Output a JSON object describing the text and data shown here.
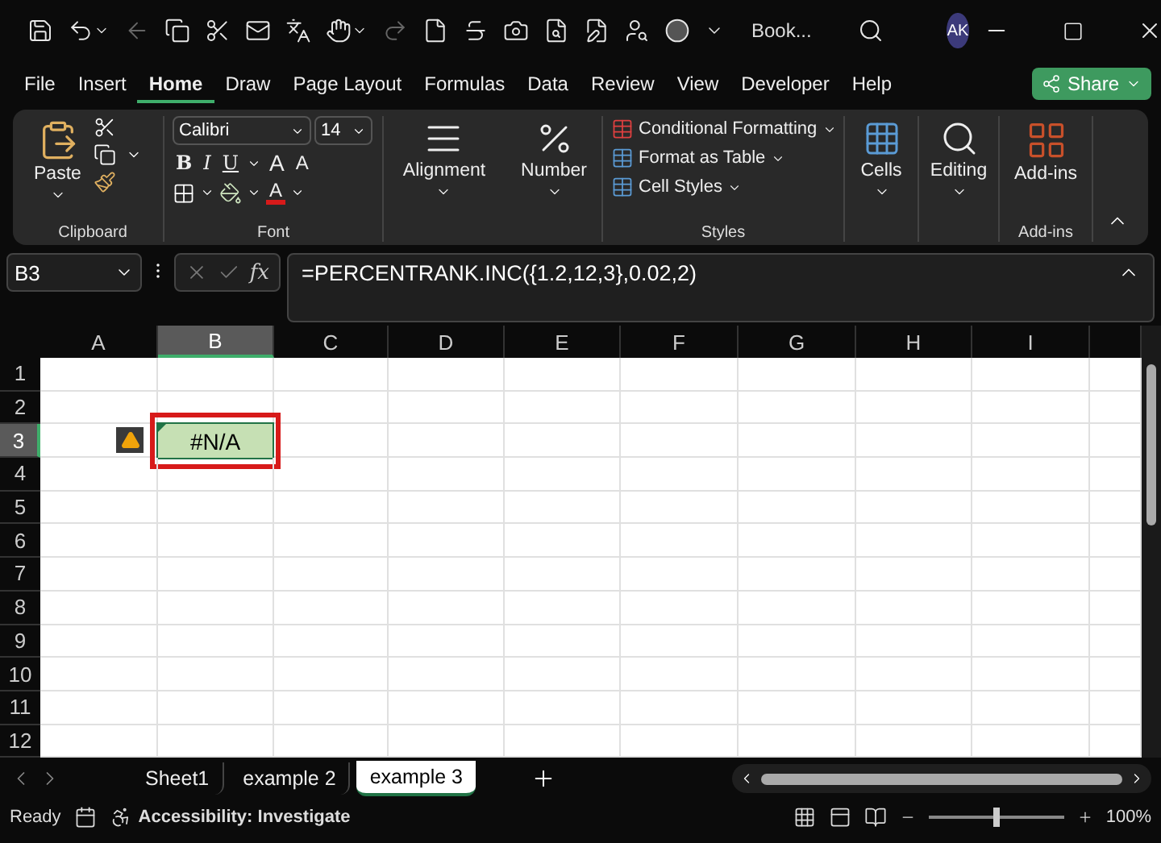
{
  "title_bar": {
    "file_name": "Book...",
    "avatar": "AK"
  },
  "menu_tabs": [
    {
      "label": "File",
      "selected": false
    },
    {
      "label": "Insert",
      "selected": false
    },
    {
      "label": "Home",
      "selected": true
    },
    {
      "label": "Draw",
      "selected": false
    },
    {
      "label": "Page Layout",
      "selected": false
    },
    {
      "label": "Formulas",
      "selected": false
    },
    {
      "label": "Data",
      "selected": false
    },
    {
      "label": "Review",
      "selected": false
    },
    {
      "label": "View",
      "selected": false
    },
    {
      "label": "Developer",
      "selected": false
    },
    {
      "label": "Help",
      "selected": false
    }
  ],
  "share_button": "Share",
  "ribbon": {
    "clipboard": {
      "paste": "Paste",
      "label": "Clipboard"
    },
    "font": {
      "name": "Calibri",
      "size": "14",
      "style_buttons": [
        "B",
        "I",
        "U"
      ],
      "size_buttons": [
        "A",
        "A"
      ],
      "color_button": "A",
      "label": "Font"
    },
    "alignment": "Alignment",
    "number": "Number",
    "styles": {
      "items": [
        "Conditional Formatting",
        "Format as Table",
        "Cell Styles"
      ],
      "label": "Styles"
    },
    "cells": "Cells",
    "editing": "Editing",
    "addins": {
      "button": "Add-ins",
      "label": "Add-ins"
    }
  },
  "formula_bar": {
    "name_box": "B3",
    "fx": "fx",
    "formula": "=PERCENTRANK.INC({1.2,12,3},0.02,2)"
  },
  "columns": [
    {
      "label": "A",
      "selected": false
    },
    {
      "label": "B",
      "selected": true
    },
    {
      "label": "C",
      "selected": false
    },
    {
      "label": "D",
      "selected": false
    },
    {
      "label": "E",
      "selected": false
    },
    {
      "label": "F",
      "selected": false
    },
    {
      "label": "G",
      "selected": false
    },
    {
      "label": "H",
      "selected": false
    },
    {
      "label": "I",
      "selected": false
    }
  ],
  "rows": [
    {
      "label": "1",
      "selected": false
    },
    {
      "label": "2",
      "selected": false
    },
    {
      "label": "3",
      "selected": true
    },
    {
      "label": "4",
      "selected": false
    },
    {
      "label": "5",
      "selected": false
    },
    {
      "label": "6",
      "selected": false
    },
    {
      "label": "7",
      "selected": false
    },
    {
      "label": "8",
      "selected": false
    },
    {
      "label": "9",
      "selected": false
    },
    {
      "label": "10",
      "selected": false
    },
    {
      "label": "11",
      "selected": false
    },
    {
      "label": "12",
      "selected": false
    }
  ],
  "active_cell": {
    "value": "#N/A",
    "warning": true,
    "highlighted": true
  },
  "sheet_tabs": [
    {
      "label": "Sheet1",
      "selected": false
    },
    {
      "label": "example 2",
      "selected": false
    },
    {
      "label": "example 3",
      "selected": true
    }
  ],
  "status_bar": {
    "status": "Ready",
    "accessibility": "Accessibility: Investigate",
    "zoom": "100%",
    "zoom_level": {
      "level": 0.5
    }
  }
}
